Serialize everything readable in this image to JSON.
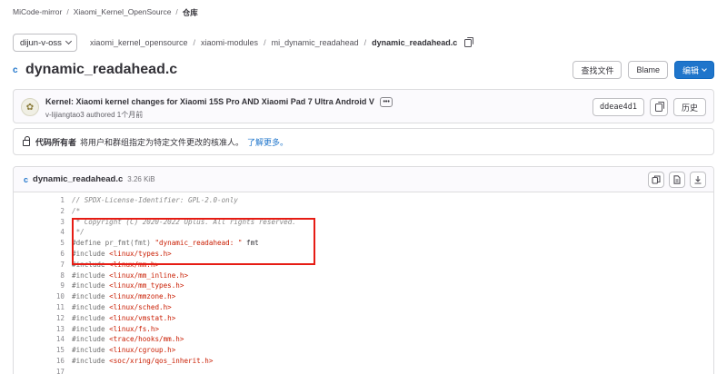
{
  "breadcrumb": [
    "MiCode-mirror",
    "Xiaomi_Kernel_OpenSource",
    "仓库"
  ],
  "branch": "dijun-v-oss",
  "path": [
    "xiaomi_kernel_opensource",
    "xiaomi-modules",
    "mi_dynamic_readahead",
    "dynamic_readahead.c"
  ],
  "file": {
    "title": "dynamic_readahead.c",
    "name": "dynamic_readahead.c",
    "size": "3.26 KiB",
    "lang_badge": "c"
  },
  "actions": {
    "find": "查找文件",
    "blame": "Blame",
    "edit": "编辑"
  },
  "commit": {
    "title": "Kernel: Xiaomi kernel changes for Xiaomi 15S Pro AND Xiaomi Pad 7 Ultra Android V",
    "author": "v-lijiangtao3",
    "authored": "authored",
    "time": "1个月前",
    "sha": "ddeae4d1",
    "history": "历史",
    "more": "•••"
  },
  "owners": {
    "label": "代码所有者",
    "text": "将用户和群组指定为特定文件更改的核准人。",
    "link": "了解更多。"
  },
  "code_lines": [
    {
      "n": "1",
      "t": "// SPDX-License-Identifier: GPL-2.0-only",
      "k": "cm"
    },
    {
      "n": "2",
      "t": "/*",
      "k": "cm"
    },
    {
      "n": "3",
      "t": " * Copyright (C) 2020-2022 Oplus. All rights reserved.",
      "k": "cm"
    },
    {
      "n": "4",
      "t": " */",
      "k": "cm"
    },
    {
      "n": "5",
      "t": "#define pr_fmt(fmt) \"dynamic_readahead: \" fmt",
      "k": "def"
    },
    {
      "n": "6",
      "t": "#include <linux/types.h>",
      "k": "inc"
    },
    {
      "n": "7",
      "t": "#include <linux/mm.h>",
      "k": "inc"
    },
    {
      "n": "8",
      "t": "#include <linux/mm_inline.h>",
      "k": "inc"
    },
    {
      "n": "9",
      "t": "#include <linux/mm_types.h>",
      "k": "inc"
    },
    {
      "n": "10",
      "t": "#include <linux/mmzone.h>",
      "k": "inc"
    },
    {
      "n": "11",
      "t": "#include <linux/sched.h>",
      "k": "inc"
    },
    {
      "n": "12",
      "t": "#include <linux/vmstat.h>",
      "k": "inc"
    },
    {
      "n": "13",
      "t": "#include <linux/fs.h>",
      "k": "inc"
    },
    {
      "n": "14",
      "t": "#include <trace/hooks/mm.h>",
      "k": "inc"
    },
    {
      "n": "15",
      "t": "#include <linux/cgroup.h>",
      "k": "inc"
    },
    {
      "n": "16",
      "t": "#include <soc/xring/qos_inherit.h>",
      "k": "inc"
    },
    {
      "n": "17",
      "t": "",
      "k": "blank"
    }
  ],
  "colors": {
    "accent": "#1f75cb",
    "highlight_box": "#e61c14"
  }
}
